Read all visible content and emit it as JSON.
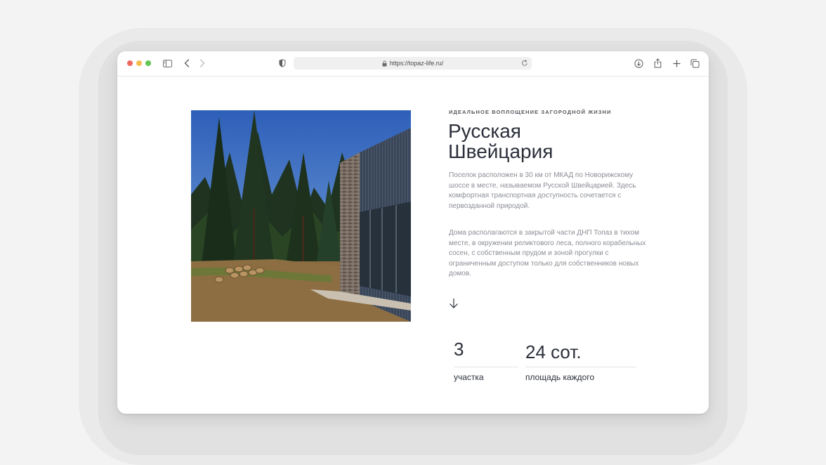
{
  "browser": {
    "url": "https://topaz-life.ru/",
    "icons": [
      "sidebar-icon",
      "back-icon",
      "forward-icon",
      "shield-icon",
      "lock-icon",
      "reload-icon",
      "download-icon",
      "share-icon",
      "new-tab-icon",
      "tabs-icon"
    ]
  },
  "hero": {
    "eyebrow": "ИДЕАЛЬНОЕ ВОПЛОЩЕНИЕ ЗАГОРОДНОЙ ЖИЗНИ",
    "title_line1": "Русская",
    "title_line2": "Швейцария",
    "paragraph1": "Поселок расположен в 30 км от МКАД по Новорижскому шоссе в месте, называемом Русской Швейцарией. Здесь комфортная транспортная доступность сочетается с первозданной природой.",
    "paragraph2": "Дома располагаются в закрытой части ДНП Топаз в тихом месте, в окружении реликтового леса, полного корабельных сосен, с собственным прудом и зоной прогулки с ограниченным доступом только для собственников новых домов."
  },
  "stats": [
    {
      "value": "3",
      "label": "участка"
    },
    {
      "value": "24 сот.",
      "label": "площадь каждого"
    }
  ],
  "colors": {
    "page_bg": "#f3f3f3",
    "window_bg": "#ffffff",
    "title": "#2b2f3a",
    "body_text": "#8b8e95"
  }
}
